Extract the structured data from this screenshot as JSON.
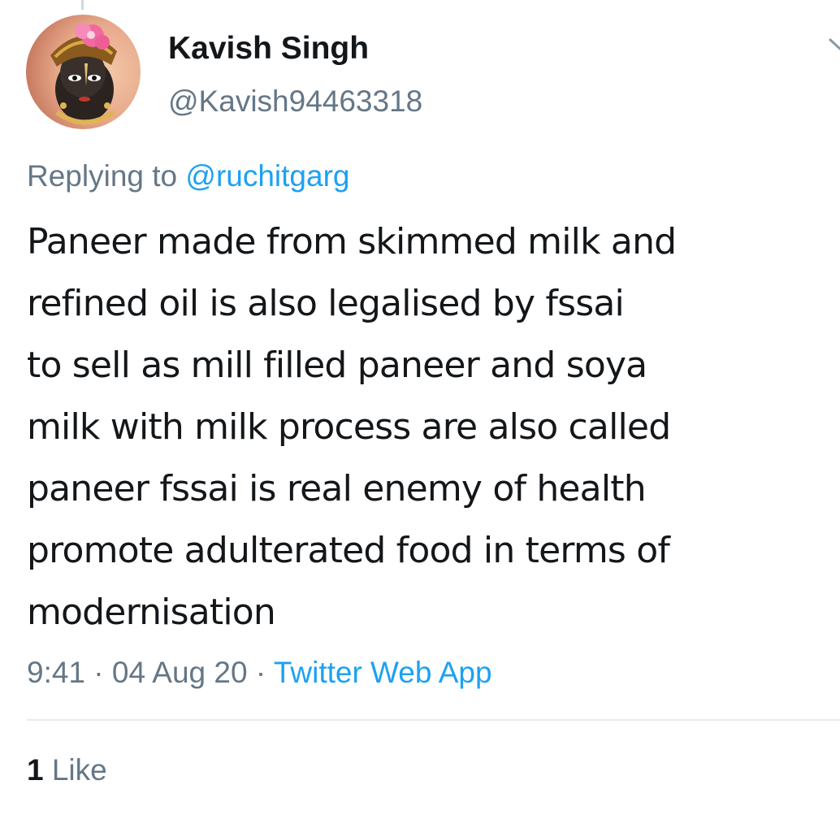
{
  "author": {
    "display_name": "Kavish Singh",
    "handle": "@Kavish94463318"
  },
  "reply": {
    "prefix": "Replying to",
    "mention": "@ruchitgarg"
  },
  "tweet": {
    "lines": [
      "Paneer made from skimmed milk and",
      "refined oil is also legalised by fssai",
      "to sell as mill filled paneer and soya",
      "milk with milk process are also called",
      "paneer fssai is real enemy of health",
      "promote adulterated food in terms of",
      "modernisation"
    ]
  },
  "meta": {
    "time": "9:41",
    "separator": "·",
    "date": "04 Aug 20",
    "source": "Twitter Web App"
  },
  "stats": {
    "likes_count": "1",
    "likes_label": "Like"
  },
  "icons": {
    "avatar": "profile-picture",
    "menu": "chevron-down-icon"
  },
  "colors": {
    "text_primary": "#14171a",
    "text_secondary": "#657786",
    "link": "#1da1f2",
    "divider": "#e6ecf0"
  }
}
